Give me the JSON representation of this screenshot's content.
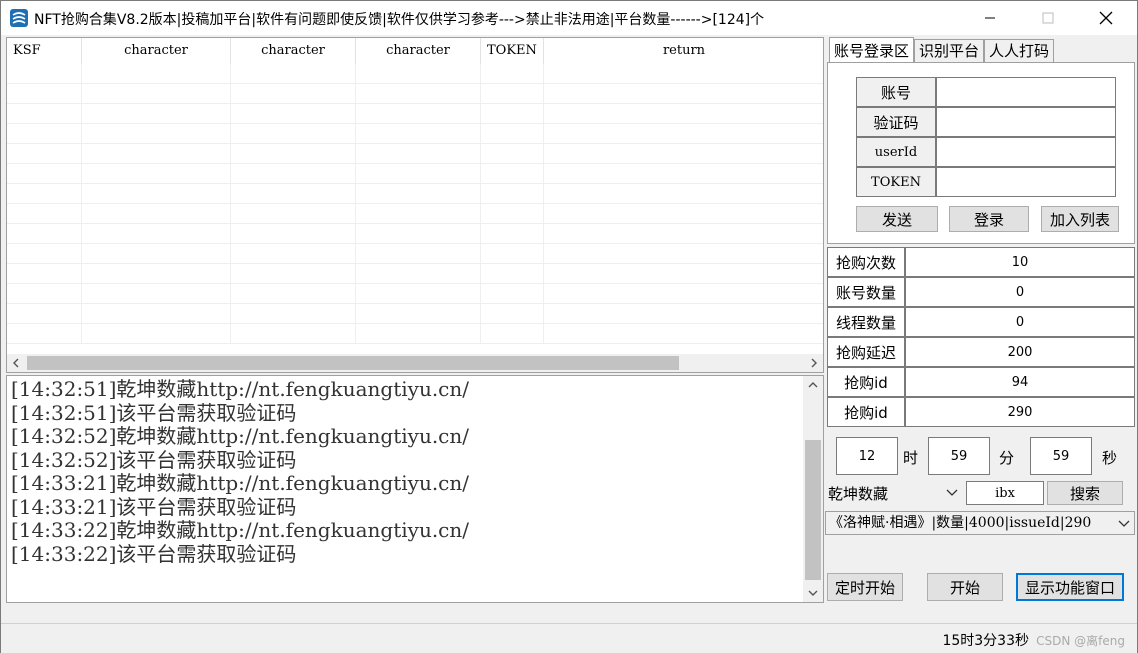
{
  "window": {
    "title": "NFT抢购合集V8.2版本|投稿加平台|软件有问题即使反馈|软件仅供学习参考--->禁止非法用途|平台数量------>[124]个"
  },
  "grid": {
    "columns": [
      "KSF",
      "character",
      "character",
      "character",
      "TOKEN",
      "return"
    ]
  },
  "log": {
    "lines": [
      "[14:32:51]乾坤数藏http://nt.fengkuangtiyu.cn/",
      "[14:32:51]该平台需获取验证码",
      "[14:32:52]乾坤数藏http://nt.fengkuangtiyu.cn/",
      "[14:32:52]该平台需获取验证码",
      "[14:33:21]乾坤数藏http://nt.fengkuangtiyu.cn/",
      "[14:33:21]该平台需获取验证码",
      "[14:33:22]乾坤数藏http://nt.fengkuangtiyu.cn/",
      "[14:33:22]该平台需获取验证码"
    ]
  },
  "tabs": [
    "账号登录区",
    "识别平台",
    "人人打码"
  ],
  "login": {
    "account_label": "账号",
    "captcha_label": "验证码",
    "userid_label": "userId",
    "token_label": "TOKEN",
    "account_value": "",
    "captcha_value": "",
    "userid_value": "",
    "token_value": "",
    "send_button": "发送",
    "login_button": "登录",
    "add_list_button": "加入列表"
  },
  "settings": [
    {
      "label": "抢购次数",
      "value": "10"
    },
    {
      "label": "账号数量",
      "value": "0"
    },
    {
      "label": "线程数量",
      "value": "0"
    },
    {
      "label": "抢购延迟",
      "value": "200"
    },
    {
      "label": "抢购id",
      "value": "94"
    },
    {
      "label": "抢购id",
      "value": "290"
    }
  ],
  "timer": {
    "hour": "12",
    "hour_unit": "时",
    "minute": "59",
    "minute_unit": "分",
    "second": "59",
    "second_unit": "秒"
  },
  "search": {
    "platform": "乾坤数藏",
    "keyword": "ibx",
    "button": "搜索"
  },
  "product_combo": "《洛神赋·相遇》|数量|4000|issueId|290",
  "actions": {
    "timed_start": "定时开始",
    "start": "开始",
    "show_window": "显示功能窗口"
  },
  "status": {
    "elapsed": "15时3分33秒",
    "watermark": "CSDN @离feng"
  },
  "colors": {
    "focus_border": "#0078d7",
    "log_text": "#333333"
  }
}
